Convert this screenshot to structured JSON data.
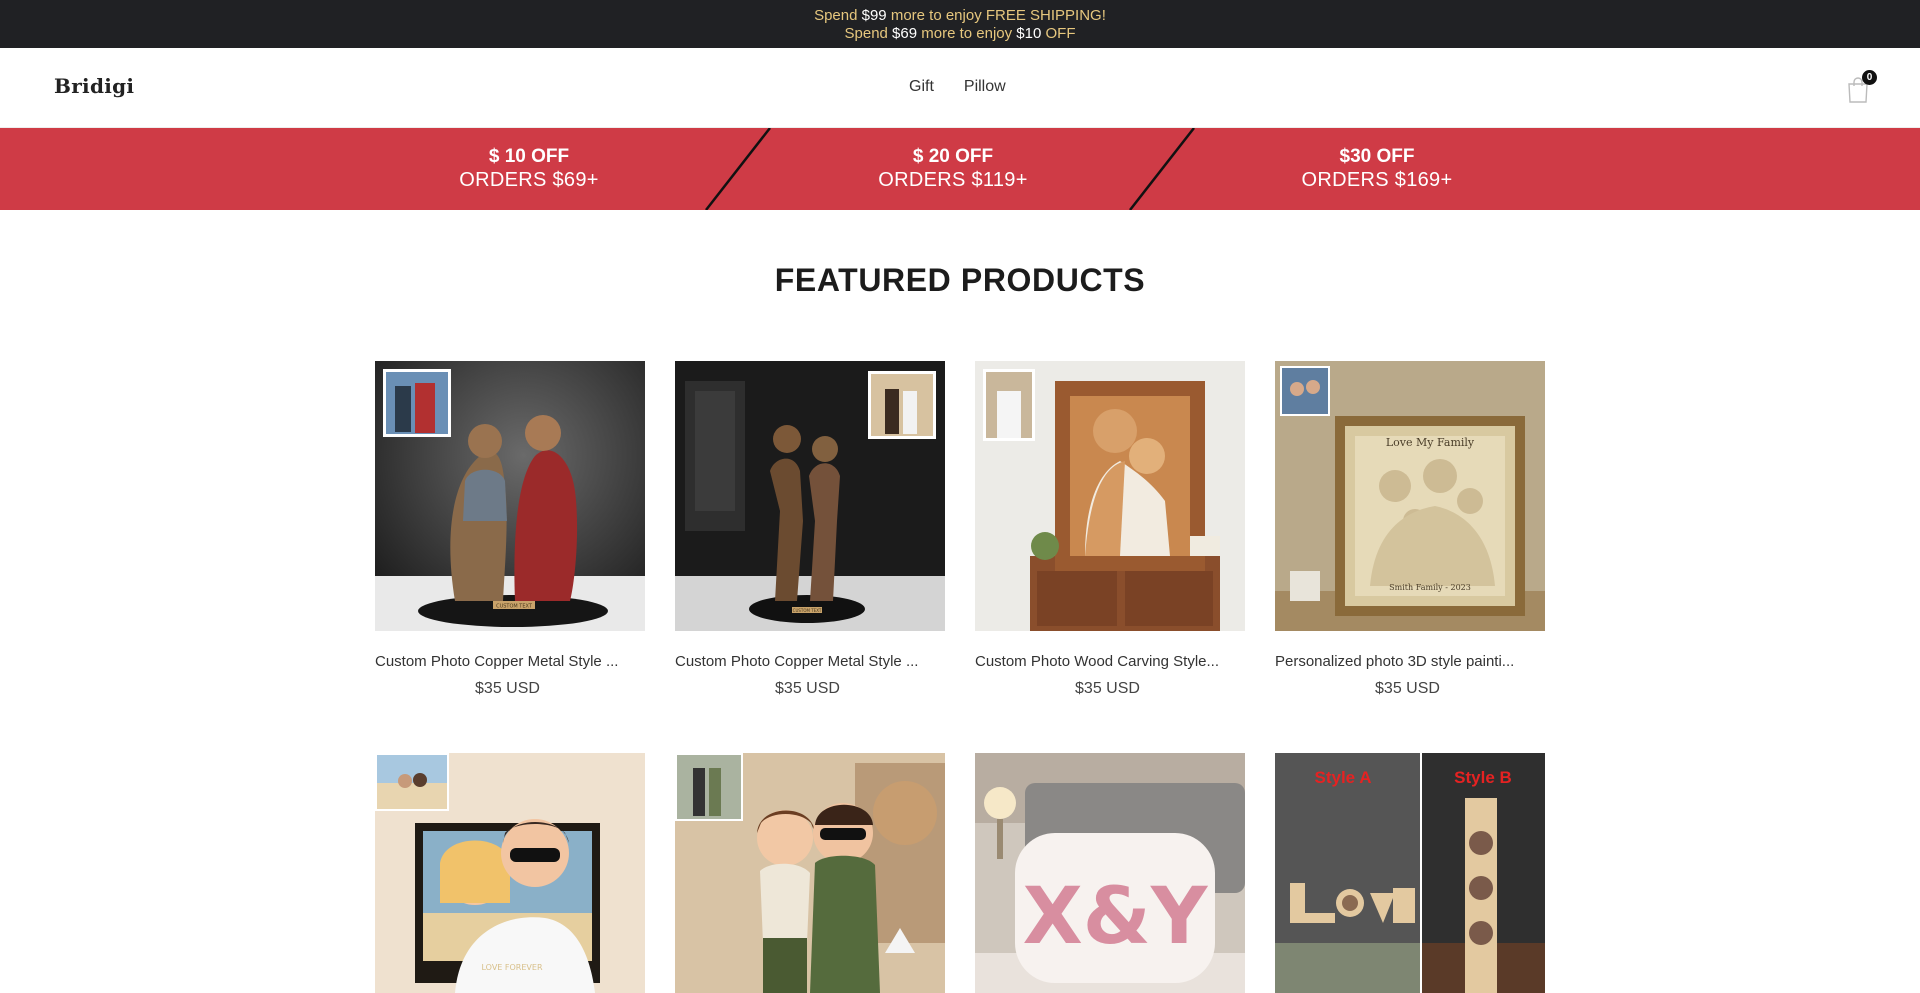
{
  "announcement": {
    "line1": {
      "pre": "Spend ",
      "amount": "$99",
      "post": " more to enjoy FREE SHIPPING!"
    },
    "line2": {
      "pre": "Spend ",
      "amount": "$69",
      "mid": " more to enjoy ",
      "discount": "$10",
      "post": " OFF"
    }
  },
  "header": {
    "logo": "Bridigi",
    "nav": [
      "Gift",
      "Pillow"
    ],
    "cart_count": "0"
  },
  "promo": [
    {
      "line1": "$ 10 OFF",
      "line2": "ORDERS $69+"
    },
    {
      "line1": "$ 20 OFF",
      "line2": "ORDERS $119+"
    },
    {
      "line1": "$30 OFF",
      "line2": "ORDERS $169+"
    }
  ],
  "section_title": "FEATURED PRODUCTS",
  "products": [
    {
      "name": "Custom Photo Copper Metal Style ...",
      "price": "$35 USD"
    },
    {
      "name": "Custom Photo Copper Metal Style ...",
      "price": "$35 USD"
    },
    {
      "name": "Custom Photo Wood Carving Style...",
      "price": "$35 USD"
    },
    {
      "name": "Personalized photo 3D style painti...",
      "price": "$35 USD"
    },
    {
      "name": "",
      "price": ""
    },
    {
      "name": "",
      "price": ""
    },
    {
      "name": "",
      "price": ""
    },
    {
      "name": "",
      "price": ""
    }
  ],
  "product_images": {
    "p1_plaque": "CUSTOM TEXT",
    "p2_plaque": "CUSTOM TEXT",
    "p4_title": "Love My Family",
    "p4_caption": "Smith Family - 2023",
    "p5_caption": "LOVE FOREVER",
    "p8_style_a": "Style A",
    "p8_style_b": "Style B",
    "p7_text": "X&Y"
  },
  "colors": {
    "announce_bg": "#202124",
    "announce_text": "#e6c77e",
    "promo_bg": "#cf3b46"
  }
}
